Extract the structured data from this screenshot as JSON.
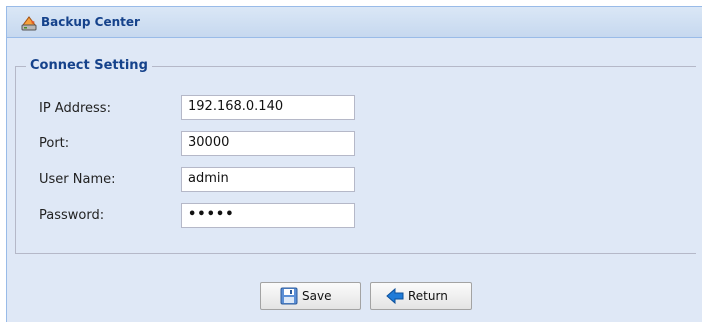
{
  "window": {
    "title": "Backup Center",
    "icon": "backup-center-icon"
  },
  "connect_setting": {
    "legend": "Connect Setting",
    "fields": [
      {
        "label": "IP Address:",
        "value": "192.168.0.140"
      },
      {
        "label": "Port:",
        "value": "30000"
      },
      {
        "label": "User Name:",
        "value": "admin"
      },
      {
        "label": "Password:",
        "value": "•••••"
      }
    ]
  },
  "buttons": {
    "save_label": "Save",
    "save_icon": "floppy-disk-icon",
    "return_label": "Return",
    "return_icon": "arrow-left-icon"
  }
}
